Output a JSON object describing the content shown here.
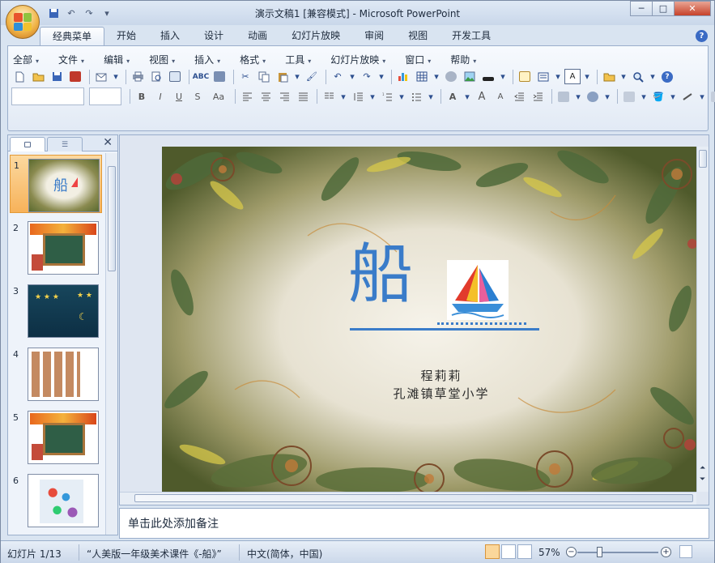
{
  "app": {
    "title": "演示文稿1 [兼容模式] - Microsoft PowerPoint",
    "quick_access": [
      "save",
      "undo",
      "redo",
      "customize"
    ]
  },
  "window_buttons": {
    "minimize": "─",
    "maximize": "□",
    "close": "✕"
  },
  "ribbon_tabs": [
    {
      "label": "经典菜单",
      "active": true
    },
    {
      "label": "开始"
    },
    {
      "label": "插入"
    },
    {
      "label": "设计"
    },
    {
      "label": "动画"
    },
    {
      "label": "幻灯片放映"
    },
    {
      "label": "审阅"
    },
    {
      "label": "视图"
    },
    {
      "label": "开发工具"
    }
  ],
  "classic_menus": [
    "全部",
    "文件",
    "编辑",
    "视图",
    "插入",
    "格式",
    "工具",
    "幻灯片放映",
    "窗口",
    "帮助"
  ],
  "toolbar_row2_text": {
    "bold": "B",
    "italic": "I",
    "underline": "U",
    "shadow": "S",
    "case": "Aa",
    "font_color": "A",
    "grow_font": "A",
    "shrink_font": "A",
    "textbox": "A"
  },
  "thumbnails": [
    {
      "num": "1",
      "selected": true,
      "theme": "floral",
      "title": "船"
    },
    {
      "num": "2",
      "theme": "chalkboard-orange"
    },
    {
      "num": "3",
      "theme": "night-sky"
    },
    {
      "num": "4",
      "theme": "boats-grid"
    },
    {
      "num": "5",
      "theme": "chalkboard-orange"
    },
    {
      "num": "6",
      "theme": "boats-collage"
    }
  ],
  "slide": {
    "title": "船",
    "author": "程莉莉",
    "school": "孔滩镇草堂小学"
  },
  "notes_placeholder": "单击此处添加备注",
  "status": {
    "slide_count": "幻灯片 1/13",
    "theme_name": "“人美版一年级美术课件《-船》”",
    "language": "中文(简体，中国)",
    "zoom": "57%"
  },
  "colors": {
    "accent": "#2e6fc4",
    "title_blue": "#3a7cc9",
    "ribbon_bg": "#e2eaf5",
    "selected_thumb": "#f7b25a"
  }
}
